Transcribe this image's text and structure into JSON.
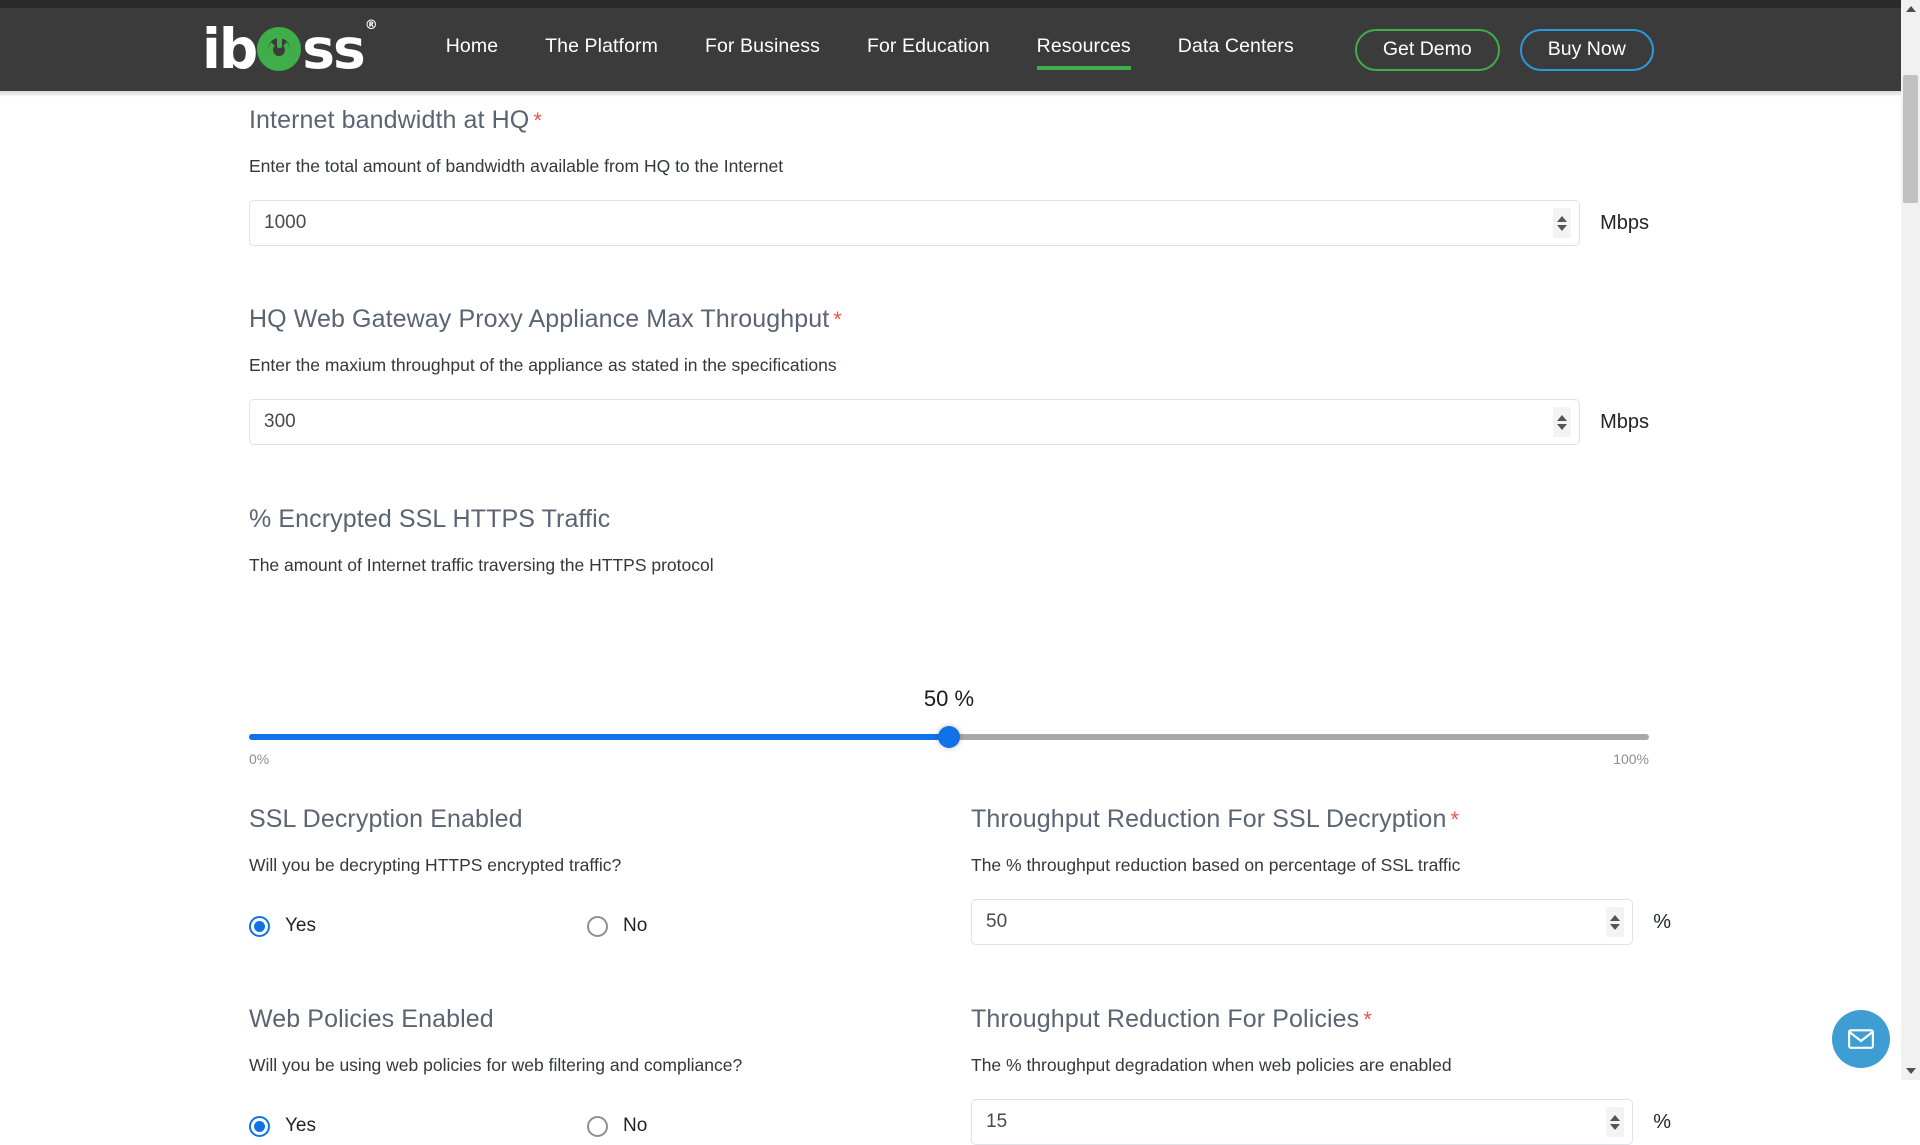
{
  "header": {
    "logo": {
      "text_before": "ib",
      "text_after": "ss",
      "trademark": "®",
      "name": "iboss"
    },
    "nav": [
      {
        "label": "Home",
        "active": false
      },
      {
        "label": "The Platform",
        "active": false
      },
      {
        "label": "For Business",
        "active": false
      },
      {
        "label": "For Education",
        "active": false
      },
      {
        "label": "Resources",
        "active": true
      },
      {
        "label": "Data Centers",
        "active": false
      }
    ],
    "buttons": {
      "demo": "Get Demo",
      "buy": "Buy Now"
    },
    "colors": {
      "bar": "#3b3b3b",
      "green": "#3fae49",
      "blue": "#2b9ada"
    }
  },
  "form": {
    "bandwidth": {
      "label": "Internet bandwidth at HQ",
      "required": "*",
      "help": "Enter the total amount of bandwidth available from HQ to the Internet",
      "value": "1000",
      "unit": "Mbps"
    },
    "proxy_throughput": {
      "label": "HQ Web Gateway Proxy Appliance Max Throughput",
      "required": "*",
      "help": "Enter the maxium throughput of the appliance as stated in the specifications",
      "value": "300",
      "unit": "Mbps"
    },
    "ssl_traffic": {
      "label": "% Encrypted SSL HTTPS Traffic",
      "help": "The amount of Internet traffic traversing the HTTPS protocol",
      "value_display": "50 %",
      "value": 50,
      "min_label": "0%",
      "max_label": "100%",
      "min": 0,
      "max": 100,
      "fill_color": "#1172e8",
      "track_color": "#a8a8a8"
    },
    "ssl_decryption": {
      "label": "SSL Decryption Enabled",
      "help": "Will you be decrypting HTTPS encrypted traffic?",
      "options": [
        {
          "label": "Yes",
          "selected": true
        },
        {
          "label": "No",
          "selected": false
        }
      ]
    },
    "ssl_reduction": {
      "label": "Throughput Reduction For SSL Decryption",
      "required": "*",
      "help": "The % throughput reduction based on percentage of SSL traffic",
      "value": "50",
      "unit": "%"
    },
    "web_policies": {
      "label": "Web Policies Enabled",
      "help": "Will you be using web policies for web filtering and compliance?",
      "options": [
        {
          "label": "Yes",
          "selected": true
        },
        {
          "label": "No",
          "selected": false
        }
      ]
    },
    "policy_reduction": {
      "label": "Throughput Reduction For Policies",
      "required": "*",
      "help": "The % throughput degradation when web policies are enabled",
      "value": "15",
      "unit": "%"
    }
  },
  "chat": {
    "icon": "envelope-icon",
    "color": "#3e9ed4"
  },
  "scrollbar": {
    "thumb_color": "#c1c1c1",
    "track_color": "#f1f1f1"
  }
}
